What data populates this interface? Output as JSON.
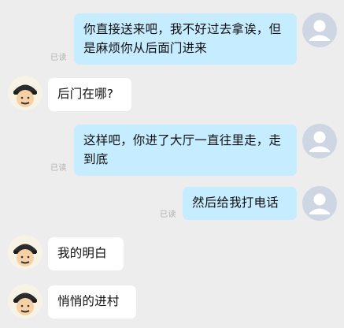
{
  "read_label": "已读",
  "messages": [
    {
      "side": "right",
      "text": "你直接送来吧，我不好过去拿诶，但是麻烦你从后面门进来"
    },
    {
      "side": "left",
      "text": "后门在哪?"
    },
    {
      "side": "right",
      "text": "这样吧，你进了大厅一直往里走，走到底"
    },
    {
      "side": "right",
      "text": "然后给我打电话"
    },
    {
      "side": "left",
      "text": "我的明白"
    },
    {
      "side": "left",
      "text": "悄悄的进村"
    }
  ],
  "colors": {
    "background": "#ededed",
    "self_bubble": "#c6ecff",
    "other_bubble": "#ffffff",
    "self_avatar_bg": "#cfd6e3",
    "read_text": "#b0b0b0"
  }
}
